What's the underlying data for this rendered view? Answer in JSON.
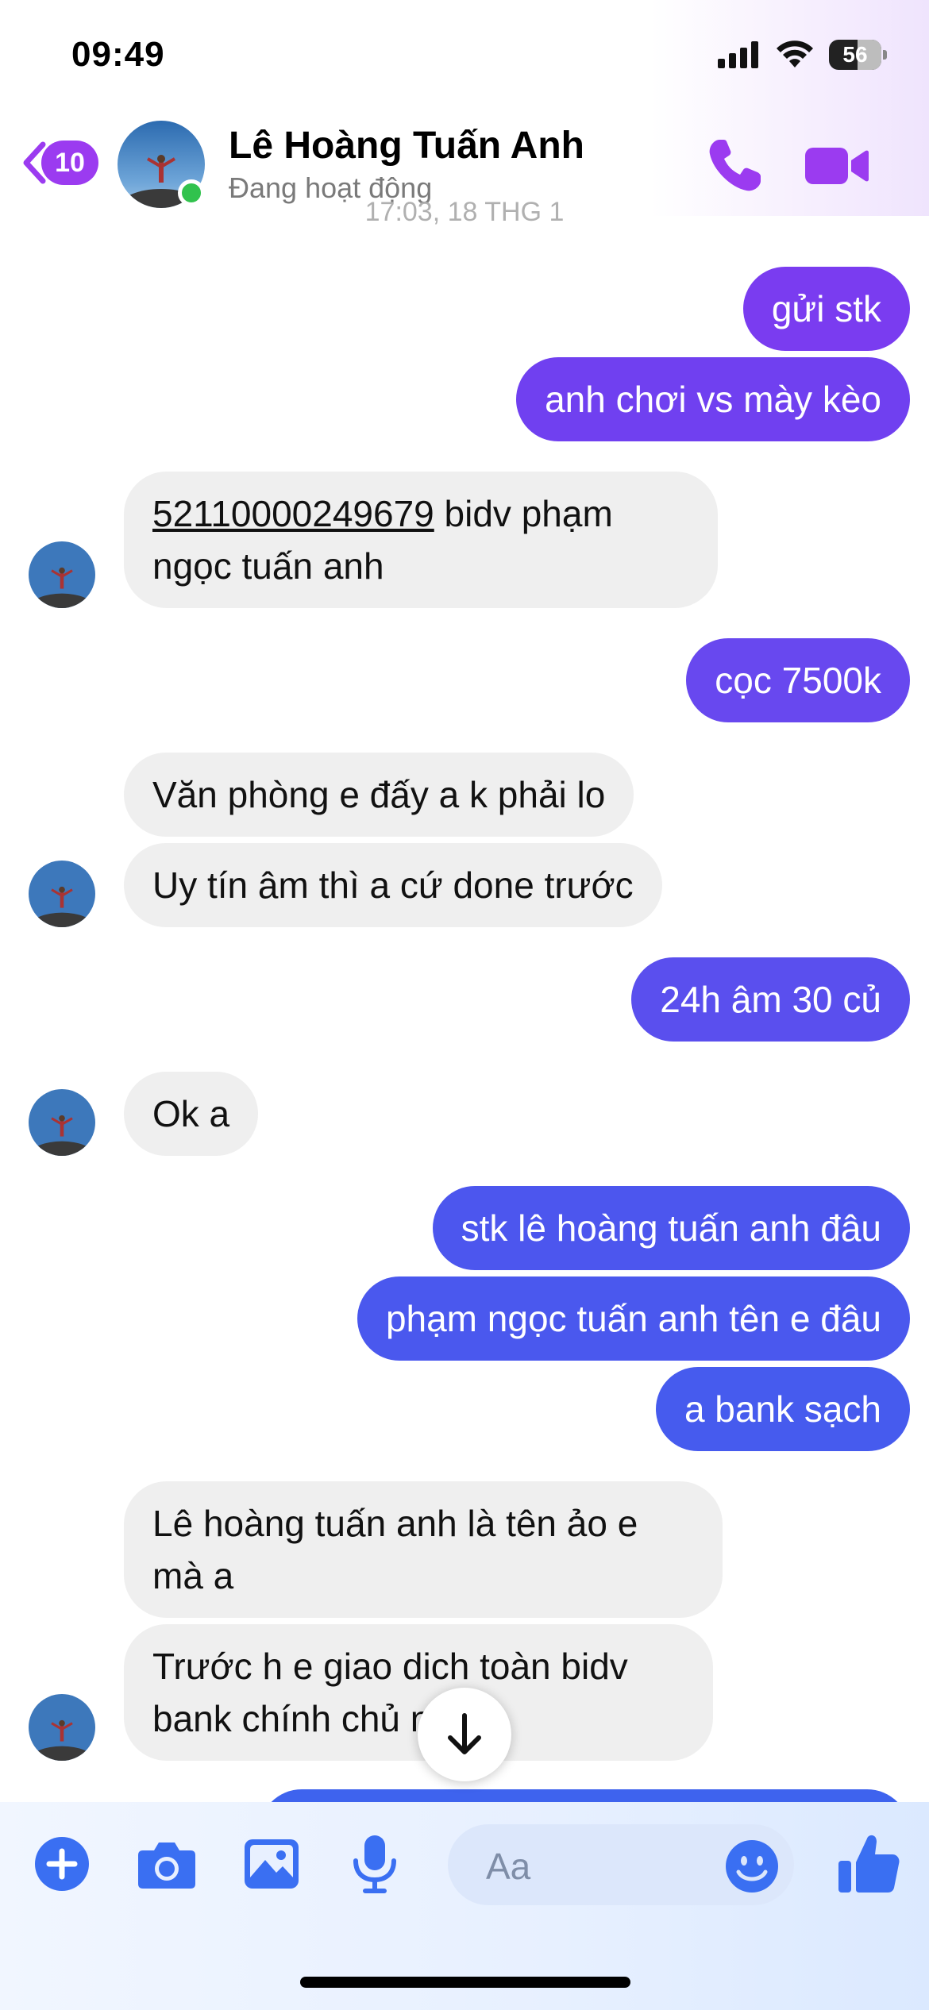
{
  "status_bar": {
    "time": "09:49",
    "battery": "56"
  },
  "header": {
    "back_count": "10",
    "contact_name": "Lê Hoàng Tuấn Anh",
    "contact_status": "Đang hoạt động",
    "timestamp_peek": "17:03, 18 THG 1"
  },
  "messages": [
    {
      "dir": "out",
      "text": "gửi stk"
    },
    {
      "dir": "out",
      "text": "anh chơi vs mày kèo"
    },
    {
      "dir": "in",
      "account": "52110000249679",
      "text_after_account": " bidv phạm",
      "line2": "ngọc tuấn anh"
    },
    {
      "dir": "out",
      "text": "cọc 7500k"
    },
    {
      "dir": "in",
      "text": "Văn phòng e đấy a k phải lo"
    },
    {
      "dir": "in",
      "text": "Uy tín âm thì a cứ done trước"
    },
    {
      "dir": "out",
      "text": "24h âm 30 củ"
    },
    {
      "dir": "in",
      "text": "Ok a"
    },
    {
      "dir": "out",
      "text": "stk lê hoàng tuấn anh đâu"
    },
    {
      "dir": "out",
      "text": "phạm ngọc tuấn anh tên e đâu"
    },
    {
      "dir": "out",
      "text": "a bank sạch"
    },
    {
      "dir": "in",
      "line1": "Lê hoàng tuấn anh là tên ảo e",
      "line2": "mà a"
    },
    {
      "dir": "in",
      "line1": "Trước h e giao dich toàn bidv",
      "line2": "bank chính chủ này"
    }
  ],
  "composer": {
    "placeholder": "Aa"
  },
  "colors": {
    "accent_purple": "#9b3bf0",
    "bubble_violet": "#7a3cf0",
    "bubble_indigo": "#4f53ee",
    "bubble_blue": "#3e63ee",
    "incoming_bg": "#efefef",
    "composer_blue": "#3a6ff2"
  },
  "icons": [
    "back-chevron-icon",
    "phone-icon",
    "video-camera-icon",
    "arrow-down-icon",
    "plus-icon",
    "camera-icon",
    "image-icon",
    "microphone-icon",
    "emoji-icon",
    "thumbs-up-icon"
  ]
}
